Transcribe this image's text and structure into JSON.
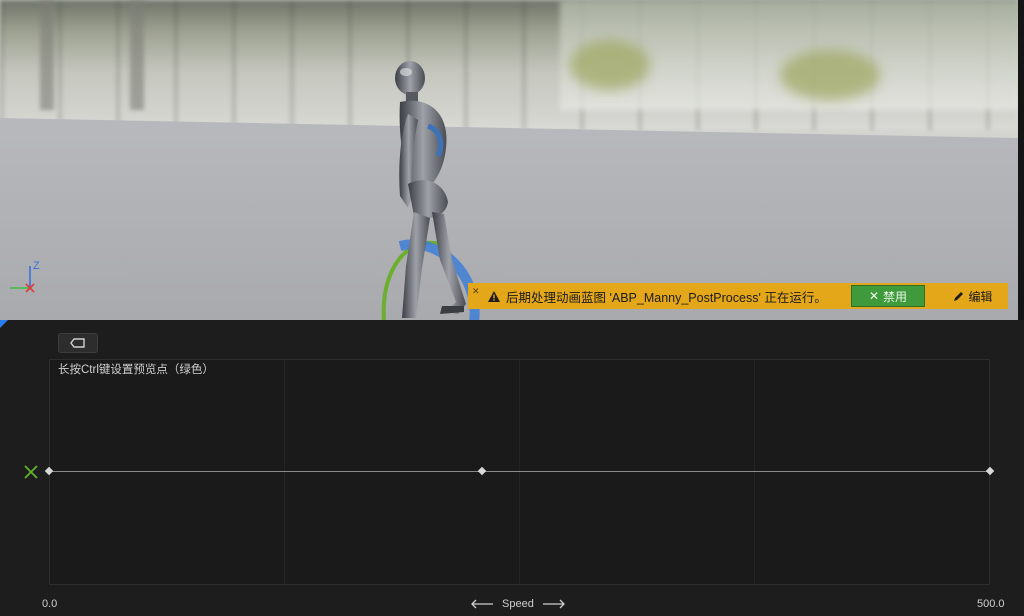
{
  "viewport": {
    "axis_gizmo": {
      "z_label": "Z",
      "icon": "axis-gizmo-icon"
    },
    "warning_bar": {
      "text": "后期处理动画蓝图 'ABP_Manny_PostProcess' 正在运行。",
      "disable_label": "禁用",
      "edit_label": "编辑",
      "close_icon": "close-icon",
      "warning_icon": "warning-triangle-icon",
      "color": "#e4a719"
    }
  },
  "editor": {
    "back_button_icon": "back-tab-icon",
    "hint": "长按Ctrl键设置预览点（绿色）",
    "preview_marker_icon": "x-marker-icon",
    "preview_marker_color": "#5fb52a",
    "axis": {
      "name": "Speed",
      "min_label": "0.0",
      "max_label": "500.0",
      "left_arrow_icon": "arrow-left-icon",
      "right_arrow_icon": "arrow-right-icon"
    },
    "sample_points": [
      0.0,
      230.0,
      500.0
    ]
  }
}
